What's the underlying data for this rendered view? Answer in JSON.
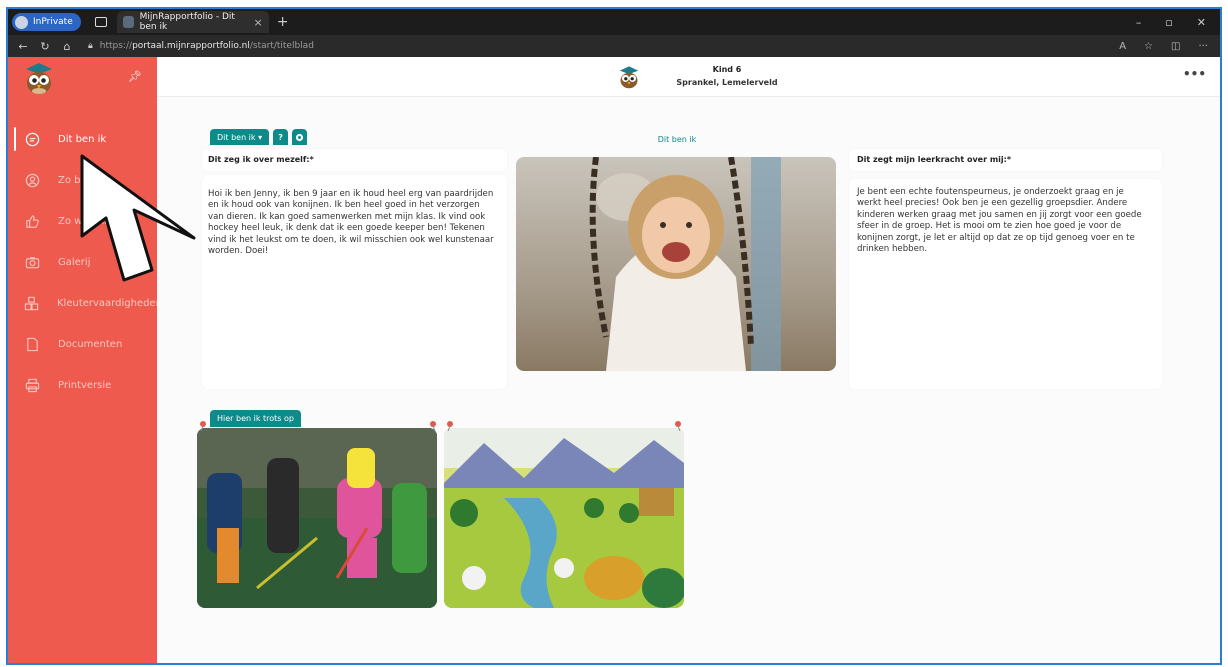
{
  "browser": {
    "inprivate_label": "InPrivate",
    "tab_title": "MijnRapportfolio - Dit ben ik",
    "tab_close": "×",
    "new_tab": "+",
    "url_prefix": "https://",
    "url_domain": "portaal.mijnrapportfolio.nl",
    "url_path": "/start/titelblad",
    "window_controls": [
      "–",
      "▫",
      "✕"
    ],
    "toolbar_icons": [
      "read-aloud-icon",
      "favorites-icon",
      "split-screen-icon",
      "more-icon"
    ]
  },
  "sidebar": {
    "items": [
      {
        "label": "Dit ben ik",
        "icon": "speech-bubble-icon",
        "active": true
      },
      {
        "label": "Zo ben ik",
        "icon": "person-circle-icon",
        "active": false
      },
      {
        "label": "Zo werk ik",
        "icon": "thumbs-up-icon",
        "active": false
      },
      {
        "label": "Galerij",
        "icon": "camera-icon",
        "active": false
      },
      {
        "label": "Kleutervaardigheden",
        "icon": "blocks-icon",
        "active": false
      },
      {
        "label": "Documenten",
        "icon": "document-icon",
        "active": false
      },
      {
        "label": "Printversie",
        "icon": "printer-icon",
        "active": false
      }
    ]
  },
  "header": {
    "child_name": "Kind 6",
    "school": "Sprankel, Lemelerveld",
    "more": "•••"
  },
  "toolbar": {
    "dropdown_label": "Dit ben ik ▾",
    "help_label": "?",
    "settings_label": "⚙"
  },
  "content": {
    "self_title": "Dit zeg ik over mezelf:*",
    "self_text": "Hoi ik ben Jenny, ik ben 9 jaar en ik houd heel erg van paardrijden en ik houd ook van konijnen. Ik ben heel goed in het verzorgen van dieren. Ik kan goed samenwerken met mijn klas. Ik vind ook hockey heel leuk, ik denk dat ik een goede keeper ben! Tekenen vind ik het leukst om te doen, ik wil misschien ook wel kunstenaar worden. Doei!",
    "photo_label": "Dit ben ik",
    "teacher_title": "Dit zegt mijn leerkracht over mij:*",
    "teacher_text": "Je bent een echte foutenspeurneus, je onderzoekt graag en je werkt heel precies! Ook ben je een gezellig groepsdier. Andere kinderen werken graag met jou samen en jij zorgt voor een goede sfeer in de groep. Het is mooi om te zien hoe goed je voor de konijnen zorgt, je let er altijd op dat ze op tijd genoeg voer en te drinken hebben.",
    "proud_label": "Hier ben ik trots op"
  },
  "colors": {
    "sidebar": "#ee5a4e",
    "accent": "#0d8a8a",
    "frame_border": "#2a7fd4"
  }
}
